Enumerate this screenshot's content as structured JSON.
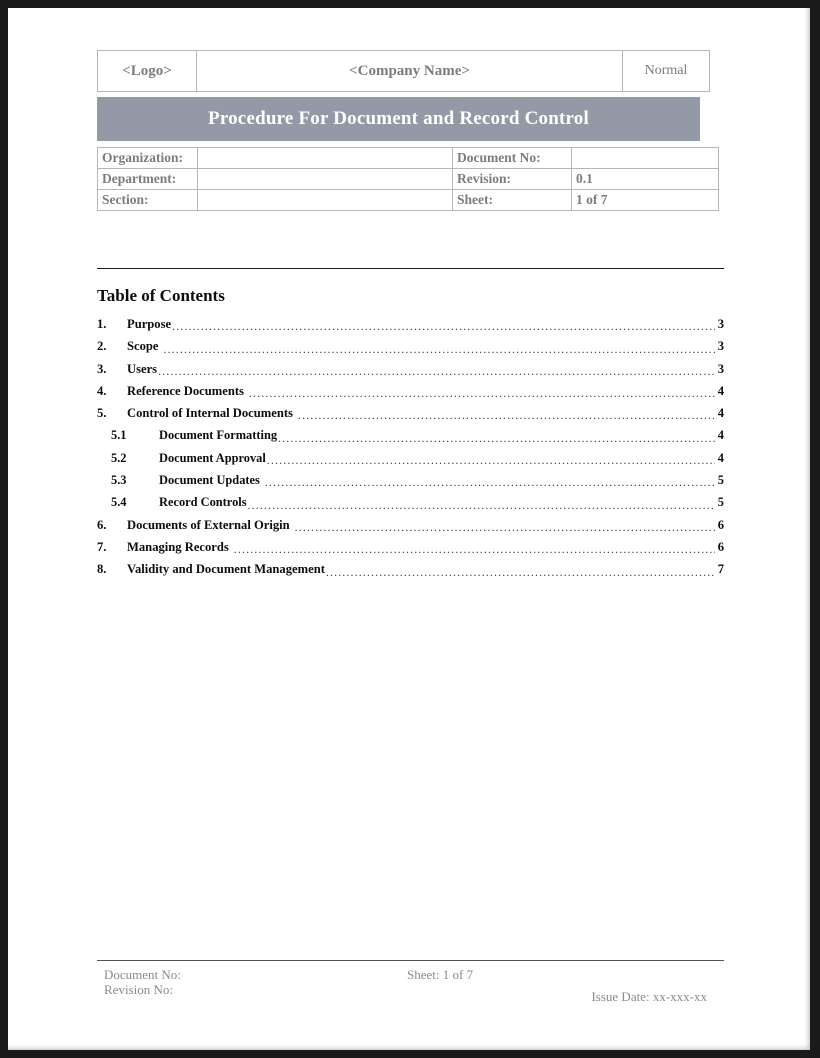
{
  "header": {
    "logo": "<Logo>",
    "company": "<Company Name>",
    "status": "Normal",
    "title": "Procedure For Document and Record Control"
  },
  "meta": {
    "rows": [
      {
        "label": "Organization:",
        "value": "",
        "label2": "Document No:",
        "value2": ""
      },
      {
        "label": "Department:",
        "value": "",
        "label2": "Revision:",
        "value2": "0.1"
      },
      {
        "label": "Section:",
        "value": "",
        "label2": "Sheet:",
        "value2": "1 of 7"
      }
    ]
  },
  "toc": {
    "heading": "Table of Contents",
    "entries": [
      {
        "num": "1.",
        "title": "Purpose",
        "page": "3",
        "level": 1,
        "gap": false
      },
      {
        "num": "2.",
        "title": "Scope",
        "page": "3",
        "level": 1,
        "gap": true
      },
      {
        "num": "3.",
        "title": "Users",
        "page": "3",
        "level": 1,
        "gap": false
      },
      {
        "num": "4.",
        "title": "Reference Documents",
        "page": "4",
        "level": 1,
        "gap": true
      },
      {
        "num": "5.",
        "title": "Control of Internal Documents",
        "page": "4",
        "level": 1,
        "gap": true
      },
      {
        "num": "5.1",
        "title": "Document Formatting",
        "page": "4",
        "level": 2,
        "gap": false
      },
      {
        "num": "5.2",
        "title": "Document Approval",
        "page": "4",
        "level": 2,
        "gap": false
      },
      {
        "num": "5.3",
        "title": "Document Updates",
        "page": "5",
        "level": 2,
        "gap": true
      },
      {
        "num": "5.4",
        "title": "Record Controls",
        "page": "5",
        "level": 2,
        "gap": false
      },
      {
        "num": "6.",
        "title": "Documents of External Origin",
        "page": "6",
        "level": 1,
        "gap": true
      },
      {
        "num": "7.",
        "title": "Managing Records",
        "page": "6",
        "level": 1,
        "gap": true
      },
      {
        "num": "8.",
        "title": "Validity and Document Management",
        "page": "7",
        "level": 1,
        "gap": false
      }
    ]
  },
  "footer": {
    "document_no": "Document No:",
    "revision_no": "Revision No:",
    "sheet": "Sheet: 1 of 7",
    "issue_date": "Issue Date: xx-xxx-xx"
  },
  "colors": {
    "banner": "#939aa5",
    "table_text": "#7c7c7c",
    "frame": "#1a1a1a"
  }
}
